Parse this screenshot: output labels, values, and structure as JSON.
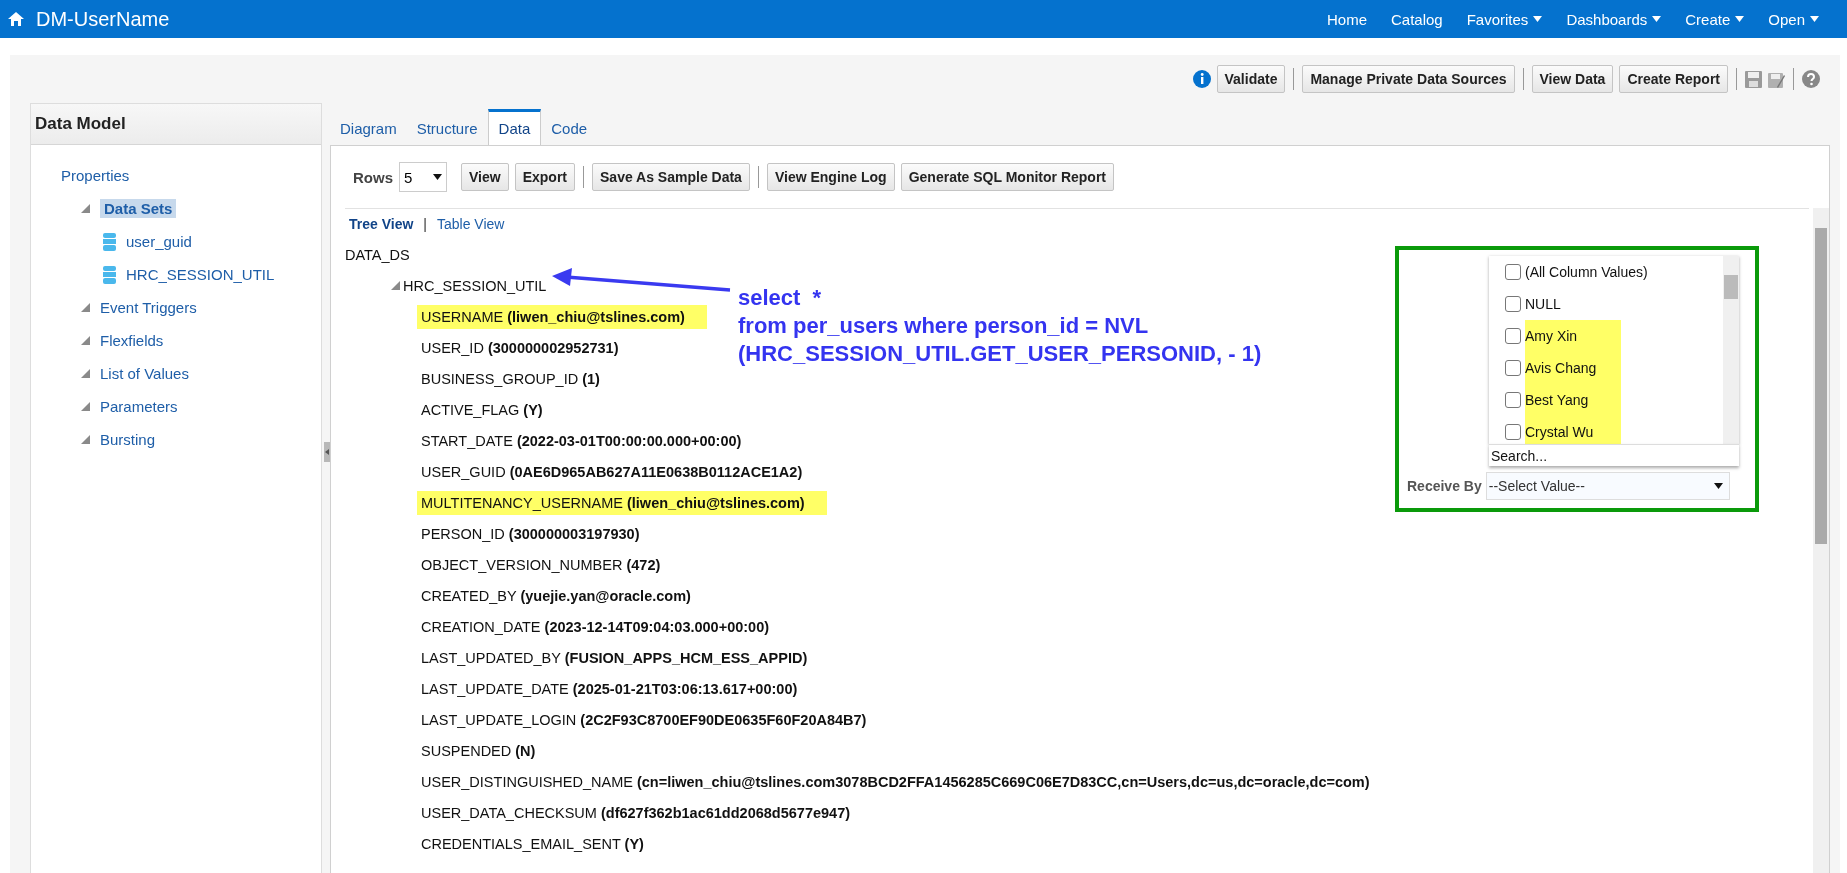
{
  "app_bar": {
    "title": "DM-UserName",
    "nav": [
      {
        "label": "Home",
        "menu": false
      },
      {
        "label": "Catalog",
        "menu": false
      },
      {
        "label": "Favorites",
        "menu": true
      },
      {
        "label": "Dashboards",
        "menu": true
      },
      {
        "label": "Create",
        "menu": true
      },
      {
        "label": "Open",
        "menu": true
      }
    ]
  },
  "toolbar": {
    "buttons": [
      "Validate",
      "Manage Private Data Sources",
      "View Data",
      "Create Report"
    ]
  },
  "sidebar": {
    "title": "Data Model",
    "items": [
      {
        "label": "Properties",
        "selected": false,
        "children": [
          {
            "label": "Data Sets",
            "selected": true,
            "children": [
              {
                "label": "user_guid",
                "selected": false
              },
              {
                "label": "HRC_SESSION_UTIL",
                "selected": false
              }
            ]
          },
          {
            "label": "Event Triggers",
            "selected": false
          },
          {
            "label": "Flexfields",
            "selected": false
          },
          {
            "label": "List of Values",
            "selected": false
          },
          {
            "label": "Parameters",
            "selected": false
          },
          {
            "label": "Bursting",
            "selected": false
          }
        ]
      }
    ]
  },
  "tabs": [
    {
      "label": "Diagram",
      "selected": false
    },
    {
      "label": "Structure",
      "selected": false
    },
    {
      "label": "Data",
      "selected": true
    },
    {
      "label": "Code",
      "selected": false
    }
  ],
  "data_toolbar": {
    "rows_label": "Rows",
    "rows_value": "5",
    "buttons": [
      "View",
      "Export",
      "Save As Sample Data",
      "View Engine Log",
      "Generate SQL Monitor Report"
    ]
  },
  "views_separator": "|",
  "views": [
    {
      "label": "Tree View",
      "selected": true
    },
    {
      "label": "Table View",
      "selected": false
    }
  ],
  "tree": {
    "label": "DATA_DS",
    "children": [
      {
        "label": "HRC_SESSION_UTIL",
        "fields": [
          {
            "name": "USERNAME",
            "value": "(liwen_chiu@tslines.com)",
            "highlighted": true
          },
          {
            "name": "USER_ID",
            "value": "(300000002952731)",
            "highlighted": false
          },
          {
            "name": "BUSINESS_GROUP_ID",
            "value": "(1)",
            "highlighted": false
          },
          {
            "name": "ACTIVE_FLAG",
            "value": "(Y)",
            "highlighted": false
          },
          {
            "name": "START_DATE",
            "value": "(2022-03-01T00:00:00.000+00:00)",
            "highlighted": false
          },
          {
            "name": "USER_GUID",
            "value": "(0AE6D965AB627A11E0638B0112ACE1A2)",
            "highlighted": false
          },
          {
            "name": "MULTITENANCY_USERNAME",
            "value": "(liwen_chiu@tslines.com)",
            "highlighted": true
          },
          {
            "name": "PERSON_ID",
            "value": "(300000003197930)",
            "highlighted": false
          },
          {
            "name": "OBJECT_VERSION_NUMBER",
            "value": "(472)",
            "highlighted": false
          },
          {
            "name": "CREATED_BY",
            "value": "(yuejie.yan@oracle.com)",
            "highlighted": false
          },
          {
            "name": "CREATION_DATE",
            "value": "(2023-12-14T09:04:03.000+00:00)",
            "highlighted": false
          },
          {
            "name": "LAST_UPDATED_BY",
            "value": "(FUSION_APPS_HCM_ESS_APPID)",
            "highlighted": false
          },
          {
            "name": "LAST_UPDATE_DATE",
            "value": "(2025-01-21T03:06:13.617+00:00)",
            "highlighted": false
          },
          {
            "name": "LAST_UPDATE_LOGIN",
            "value": "(2C2F93C8700EF90DE0635F60F20A84B7)",
            "highlighted": false
          },
          {
            "name": "SUSPENDED",
            "value": "(N)",
            "highlighted": false
          },
          {
            "name": "USER_DISTINGUISHED_NAME",
            "value": "(cn=liwen_chiu@tslines.com3078BCD2FFA1456285C669C06E7D83CC,cn=Users,dc=us,dc=oracle,dc=com)",
            "highlighted": false
          },
          {
            "name": "USER_DATA_CHECKSUM",
            "value": "(df627f362b1ac61dd2068d5677e947)",
            "highlighted": false
          },
          {
            "name": "CREDENTIALS_EMAIL_SENT",
            "value": "(Y)",
            "highlighted": false
          }
        ]
      }
    ]
  },
  "annotation": {
    "lines": [
      "select  *",
      "from per_users where person_id = NVL",
      "(HRC_SESSION_UTIL.GET_USER_PERSONID, - 1)"
    ]
  },
  "filter_popup": {
    "options": [
      {
        "label": "(All Column Values)",
        "checked": false,
        "highlighted": false
      },
      {
        "label": "NULL",
        "checked": false,
        "highlighted": false
      },
      {
        "label": "Amy Xin",
        "checked": false,
        "highlighted": true
      },
      {
        "label": "Avis Chang",
        "checked": false,
        "highlighted": true
      },
      {
        "label": "Best Yang",
        "checked": false,
        "highlighted": true
      },
      {
        "label": "Crystal Wu",
        "checked": false,
        "highlighted": true
      }
    ],
    "search_placeholder": "Search...",
    "field_label": "Receive By",
    "select_value": "--Select Value--"
  }
}
